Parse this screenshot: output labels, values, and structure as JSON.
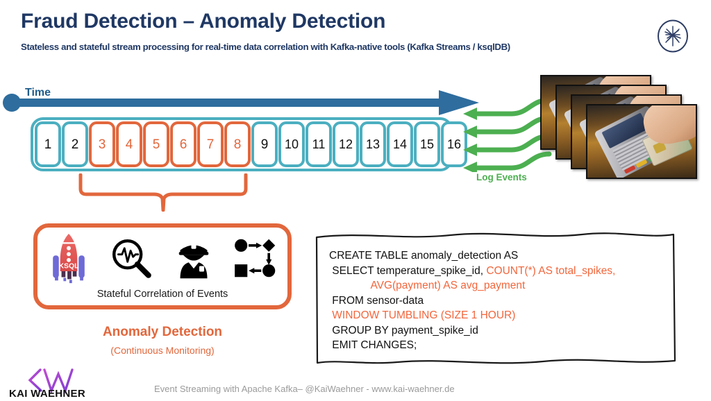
{
  "header": {
    "title": "Fraud Detection – Anomaly Detection",
    "subtitle": "Stateless and stateful stream processing for real-time data correlation with Kafka-native tools (Kafka Streams / ksqlDB)",
    "logo_icon": "confluent-logo-icon",
    "title_color": "#1F3864"
  },
  "timeline": {
    "axis_label": "Time",
    "axis_color": "#2E6D9E",
    "normal_color": "#4BAFC0",
    "highlight_color": "#E2673C",
    "boxes": [
      {
        "label": "1",
        "highlighted": false
      },
      {
        "label": "2",
        "highlighted": false
      },
      {
        "label": "3",
        "highlighted": true
      },
      {
        "label": "4",
        "highlighted": true
      },
      {
        "label": "5",
        "highlighted": true
      },
      {
        "label": "6",
        "highlighted": true
      },
      {
        "label": "7",
        "highlighted": true
      },
      {
        "label": "8",
        "highlighted": true
      },
      {
        "label": "9",
        "highlighted": false
      },
      {
        "label": "10",
        "highlighted": false
      },
      {
        "label": "11",
        "highlighted": false
      },
      {
        "label": "12",
        "highlighted": false
      },
      {
        "label": "13",
        "highlighted": false
      },
      {
        "label": "14",
        "highlighted": false
      },
      {
        "label": "15",
        "highlighted": false
      },
      {
        "label": "16",
        "highlighted": false
      }
    ]
  },
  "events": {
    "label": "Log Events",
    "color": "#4CAF50",
    "arrow_count": 4,
    "source_image": "payment-terminal-card-photo",
    "photo_count": 4
  },
  "detection": {
    "caption": "Stateful Correlation of Events",
    "title": "Anomaly Detection",
    "subtitle": "(Continuous Monitoring)",
    "accent_color": "#E2673C",
    "icons": [
      {
        "name": "ksql-rocket-icon",
        "label": "KSQL"
      },
      {
        "name": "pulse-magnifier-icon",
        "label": ""
      },
      {
        "name": "police-officer-icon",
        "label": ""
      },
      {
        "name": "flow-diagram-icon",
        "label": ""
      }
    ]
  },
  "sql": {
    "keyword_color": "#F2663C",
    "lines": [
      {
        "segments": [
          {
            "text": "CREATE TABLE anomaly_detection AS",
            "kw": false
          }
        ]
      },
      {
        "segments": [
          {
            "text": " SELECT temperature_spike_id, ",
            "kw": false
          },
          {
            "text": "COUNT(*) AS total_spikes,",
            "kw": true
          }
        ]
      },
      {
        "segments": [
          {
            "text": "              ",
            "kw": false
          },
          {
            "text": "AVG(payment) AS avg_payment",
            "kw": true
          }
        ]
      },
      {
        "segments": [
          {
            "text": " FROM sensor-data",
            "kw": false
          }
        ]
      },
      {
        "segments": [
          {
            "text": " WINDOW TUMBLING (SIZE 1 HOUR)",
            "kw": true
          }
        ]
      },
      {
        "segments": [
          {
            "text": " GROUP BY payment_spike_id",
            "kw": false
          }
        ]
      },
      {
        "segments": [
          {
            "text": " EMIT CHANGES;",
            "kw": false
          }
        ]
      }
    ]
  },
  "footer": {
    "brand": "KAI WAEHNER",
    "brand_mark": "KW",
    "text": "Event Streaming with Apache Kafka– @KaiWaehner - www.kai-waehner.de"
  }
}
